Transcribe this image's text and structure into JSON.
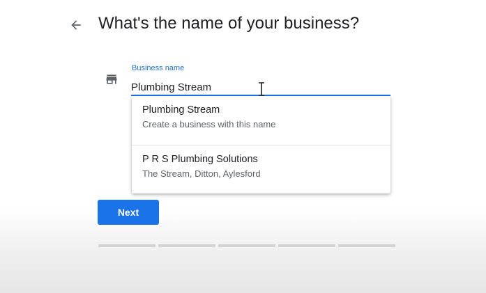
{
  "header": {
    "title": "What's the name of your business?"
  },
  "icons": {
    "back": "arrow-back-icon",
    "field": "store-icon",
    "cursor": "text-cursor-icon"
  },
  "form": {
    "label": "Business name",
    "value": "Plumbing Stream"
  },
  "suggestions": [
    {
      "title": "Plumbing Stream",
      "subtitle": "Create a business with this name"
    },
    {
      "title": "P R S Plumbing Solutions",
      "subtitle": "The Stream, Ditton, Aylesford"
    }
  ],
  "actions": {
    "next_label": "Next"
  },
  "progress": {
    "total_steps": 5
  },
  "colors": {
    "accent": "#1a73e8",
    "title_text": "#202124",
    "secondary_text": "#5f6368"
  }
}
